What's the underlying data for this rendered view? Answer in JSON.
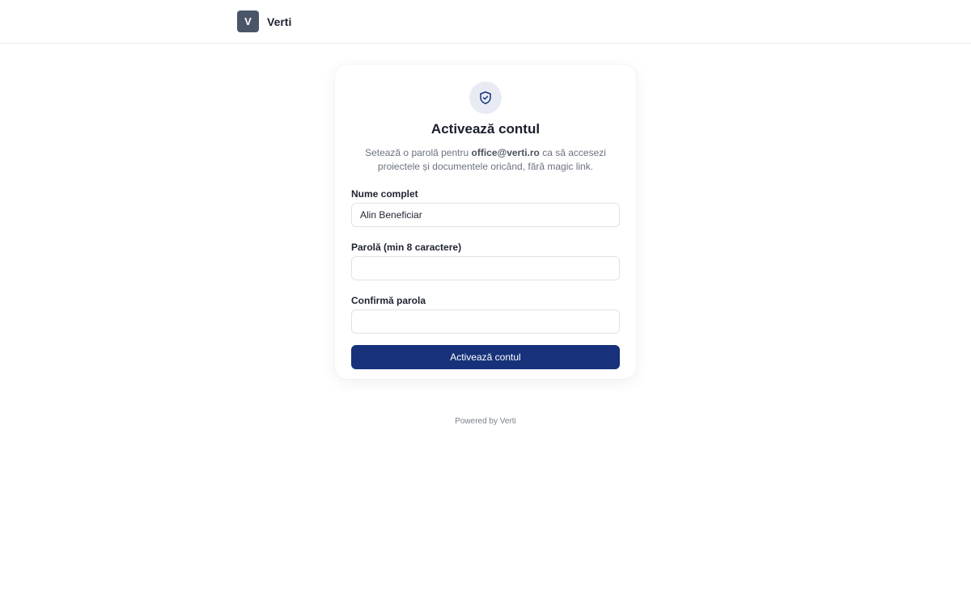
{
  "header": {
    "logo_letter": "V",
    "brand_name": "Verti"
  },
  "card": {
    "title": "Activează contul",
    "description_prefix": "Setează o parolă pentru ",
    "email": "office@verti.ro",
    "description_suffix": " ca să accesezi proiectele și documentele oricând, fără magic link.",
    "fields": {
      "name": {
        "label": "Nume complet",
        "value": "Alin Beneficiar",
        "placeholder": ""
      },
      "password": {
        "label": "Parolă (min 8 caractere)",
        "value": "",
        "placeholder": ""
      },
      "confirm": {
        "label": "Confirmă parola",
        "value": "",
        "placeholder": ""
      }
    },
    "submit_label": "Activează contul"
  },
  "footer": {
    "text": "Powered by Verti"
  },
  "colors": {
    "accent": "#17327a",
    "logo_bg": "#4a5568",
    "icon_bg": "#e8ebf3"
  },
  "icons": {
    "card_icon": "shield-check-icon"
  }
}
